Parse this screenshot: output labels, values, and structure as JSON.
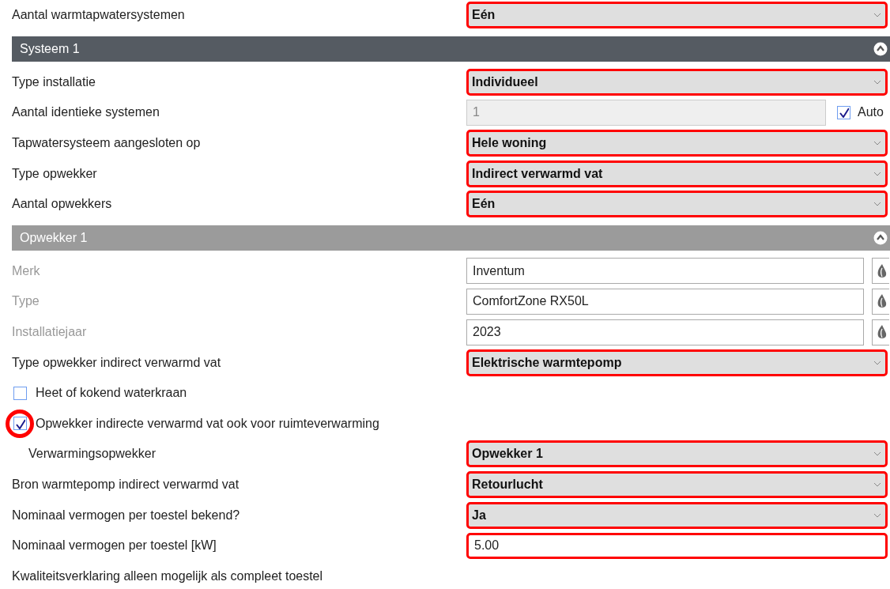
{
  "rows": [
    {
      "kind": "select",
      "label": "Aantal warmtapwatersystemen",
      "value": "Eén",
      "highlighted": true
    },
    {
      "kind": "header",
      "title": "Systeem 1",
      "expanded": true
    },
    {
      "kind": "select",
      "label": "Type installatie",
      "value": "Individueel",
      "highlighted": true
    },
    {
      "kind": "text",
      "label": "Aantal identieke systemen",
      "value": "1",
      "disabled": true,
      "auto": {
        "label": "Auto",
        "checked": true
      }
    },
    {
      "kind": "select",
      "label": "Tapwatersysteem aangesloten op",
      "value": "Hele woning",
      "highlighted": true
    },
    {
      "kind": "select",
      "label": "Type opwekker",
      "value": "Indirect verwarmd vat",
      "highlighted": true
    },
    {
      "kind": "select",
      "label": "Aantal opwekkers",
      "value": "Eén",
      "highlighted": true
    },
    {
      "kind": "subheader",
      "title": "Opwekker 1",
      "expanded": true
    },
    {
      "kind": "text",
      "label": "Merk",
      "label_greyed": true,
      "value": "Inventum",
      "lookup": true
    },
    {
      "kind": "text",
      "label": "Type",
      "label_greyed": true,
      "value": "ComfortZone RX50L",
      "lookup": true
    },
    {
      "kind": "text",
      "label": "Installatiejaar",
      "label_greyed": true,
      "value": "2023",
      "lookup": true
    },
    {
      "kind": "select",
      "label": "Type opwekker indirect verwarmd vat",
      "value": "Elektrische warmtepomp",
      "highlighted": true
    },
    {
      "kind": "checkbox",
      "label": "Heet of kokend waterkraan",
      "checked": false
    },
    {
      "kind": "checkbox",
      "label": "Opwekker indirecte verwarmd vat ook voor ruimteverwarming",
      "checked": true,
      "circled": true,
      "children": [
        {
          "kind": "select",
          "label": "Verwarmingsopwekker",
          "value": "Opwekker 1",
          "highlighted": true
        }
      ]
    },
    {
      "kind": "select",
      "label": "Bron warmtepomp indirect verwarmd vat",
      "value": "Retourlucht",
      "highlighted": true
    },
    {
      "kind": "select",
      "label": "Nominaal vermogen per toestel bekend?",
      "value": "Ja",
      "highlighted": true
    },
    {
      "kind": "text",
      "label": "Nominaal vermogen per toestel [kW]",
      "value": "5.00",
      "highlighted": true
    },
    {
      "kind": "note",
      "text": "Kwaliteitsverklaring alleen mogelijk als compleet toestel"
    }
  ]
}
